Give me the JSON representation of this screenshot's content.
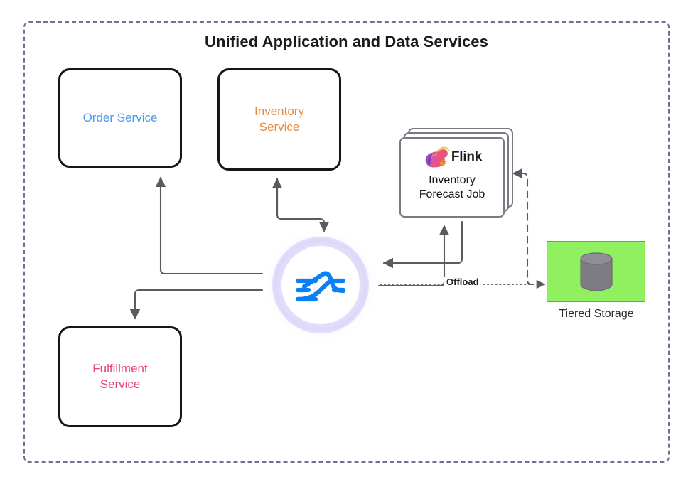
{
  "diagram": {
    "title": "Unified Application and Data Services",
    "boundary_style": "dashed",
    "boundary_color": "#69758f"
  },
  "services": [
    {
      "id": "order-service",
      "label": "Order Service",
      "color": "#4a9bf0"
    },
    {
      "id": "inventory-service",
      "label": "Inventory\nService",
      "color": "#e8883a"
    },
    {
      "id": "fulfillment-service",
      "label": "Fulfillment\nService",
      "color": "#ea3e7c"
    }
  ],
  "messaging": {
    "id": "pulsar-node",
    "icon": "apache-pulsar-icon",
    "accent_color": "#0b7ff5",
    "glow_color": "#c4b8f7"
  },
  "stream_job": {
    "brand": "Flink",
    "icon": "flink-squirrel-icon",
    "name": "Inventory\nForecast Job",
    "stacked_layers": 3
  },
  "storage": {
    "id": "tiered-storage",
    "label": "Tiered Storage",
    "icon": "database-cylinder-icon",
    "fill_color": "#90f05f",
    "border_color": "#6aa84f",
    "cylinder_color": "#7c7c82"
  },
  "edges": [
    {
      "id": "pulsar-to-order",
      "from": "pulsar-node",
      "to": "order-service",
      "style": "solid",
      "label": ""
    },
    {
      "id": "pulsar-to-inventory",
      "from": "pulsar-node",
      "to": "inventory-service",
      "style": "solid",
      "label": ""
    },
    {
      "id": "inventory-to-pulsar",
      "from": "inventory-service",
      "to": "pulsar-node",
      "style": "solid",
      "label": ""
    },
    {
      "id": "pulsar-to-fulfillment",
      "from": "pulsar-node",
      "to": "fulfillment-service",
      "style": "solid",
      "label": ""
    },
    {
      "id": "pulsar-to-flink",
      "from": "pulsar-node",
      "to": "stream-job",
      "style": "solid",
      "label": ""
    },
    {
      "id": "flink-to-pulsar",
      "from": "stream-job",
      "to": "pulsar-node",
      "style": "solid",
      "label": ""
    },
    {
      "id": "storage-to-flink",
      "from": "tiered-storage",
      "to": "stream-job",
      "style": "dashed",
      "label": ""
    },
    {
      "id": "pulsar-to-storage",
      "from": "pulsar-node",
      "to": "tiered-storage",
      "style": "dotted",
      "label": "Offload"
    }
  ],
  "labels": {
    "offload": "Offload"
  }
}
